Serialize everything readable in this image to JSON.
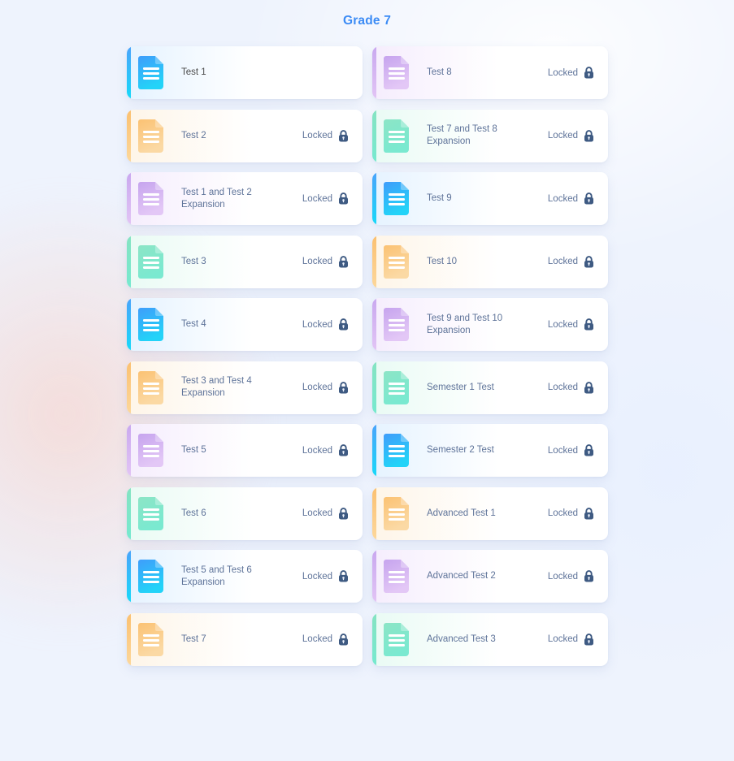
{
  "page": {
    "title": "Grade 7",
    "title_color": "#3b8bf5",
    "background_color": "#eef3fd"
  },
  "labels": {
    "locked": "Locked",
    "lock_icon": "padlock-icon",
    "document_icon": "document-icon"
  },
  "theme_colors": {
    "blue": "#4aa3fb",
    "blue_end": "#17d9f9",
    "orange": "#fbc070",
    "orange_end": "#fcd79b",
    "purple": "#c9a8ef",
    "purple_end": "#e2c4f5",
    "green": "#85e3c2",
    "green_end": "#76e9cf",
    "locked_text": "#5e7399",
    "unlocked_text": "#4a4a4a"
  },
  "columns": {
    "left": [
      {
        "title": "Test 1",
        "status": "",
        "locked": false,
        "theme": "blue",
        "two_line": false
      },
      {
        "title": "Test 2",
        "status": "Locked",
        "locked": true,
        "theme": "orange",
        "two_line": false
      },
      {
        "title": "Test 1 and Test 2\nExpansion",
        "status": "Locked",
        "locked": true,
        "theme": "purple",
        "two_line": true
      },
      {
        "title": "Test 3",
        "status": "Locked",
        "locked": true,
        "theme": "green",
        "two_line": false
      },
      {
        "title": "Test 4",
        "status": "Locked",
        "locked": true,
        "theme": "blue",
        "two_line": false
      },
      {
        "title": "Test 3 and Test 4\nExpansion",
        "status": "Locked",
        "locked": true,
        "theme": "orange",
        "two_line": true
      },
      {
        "title": "Test 5",
        "status": "Locked",
        "locked": true,
        "theme": "purple",
        "two_line": false
      },
      {
        "title": "Test 6",
        "status": "Locked",
        "locked": true,
        "theme": "green",
        "two_line": false
      },
      {
        "title": "Test 5 and Test 6\nExpansion",
        "status": "Locked",
        "locked": true,
        "theme": "blue",
        "two_line": true
      },
      {
        "title": "Test 7",
        "status": "Locked",
        "locked": true,
        "theme": "orange",
        "two_line": false
      }
    ],
    "right": [
      {
        "title": "Test 8",
        "status": "Locked",
        "locked": true,
        "theme": "purple",
        "two_line": false
      },
      {
        "title": "Test 7 and Test 8\nExpansion",
        "status": "Locked",
        "locked": true,
        "theme": "green",
        "two_line": true
      },
      {
        "title": "Test 9",
        "status": "Locked",
        "locked": true,
        "theme": "blue",
        "two_line": false
      },
      {
        "title": "Test 10",
        "status": "Locked",
        "locked": true,
        "theme": "orange",
        "two_line": false
      },
      {
        "title": "Test 9 and Test 10\nExpansion",
        "status": "Locked",
        "locked": true,
        "theme": "purple",
        "two_line": true
      },
      {
        "title": "Semester 1 Test",
        "status": "Locked",
        "locked": true,
        "theme": "green",
        "two_line": false
      },
      {
        "title": "Semester 2 Test",
        "status": "Locked",
        "locked": true,
        "theme": "blue",
        "two_line": false
      },
      {
        "title": "Advanced Test 1",
        "status": "Locked",
        "locked": true,
        "theme": "orange",
        "two_line": false
      },
      {
        "title": "Advanced Test 2",
        "status": "Locked",
        "locked": true,
        "theme": "purple",
        "two_line": false
      },
      {
        "title": "Advanced Test 3",
        "status": "Locked",
        "locked": true,
        "theme": "green",
        "two_line": false
      }
    ]
  }
}
